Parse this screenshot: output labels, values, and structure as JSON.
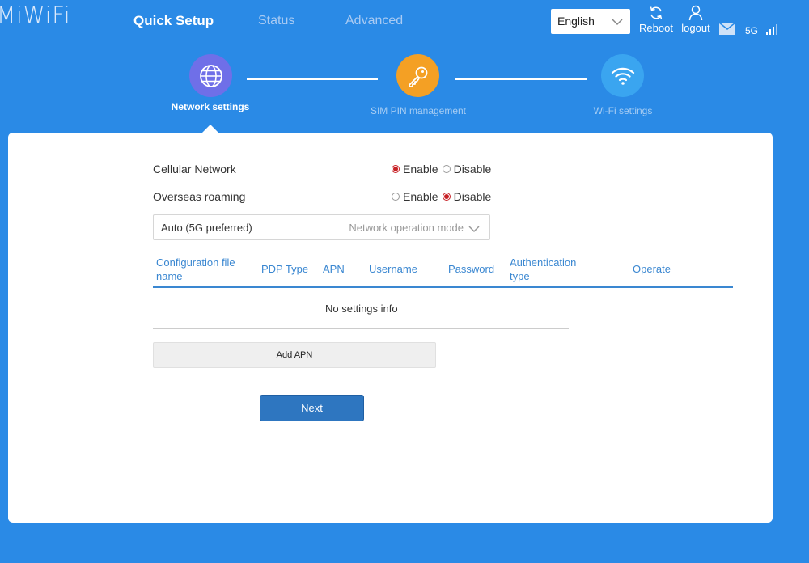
{
  "header": {
    "logo": "MiWiFi",
    "nav": [
      "Quick Setup",
      "Status",
      "Advanced"
    ],
    "language": "English",
    "reboot_label": "Reboot",
    "logout_label": "logout",
    "network_type": "5G"
  },
  "steps": [
    {
      "label": "Network settings",
      "icon": "globe-icon",
      "color": "#6f6fe8",
      "active": true
    },
    {
      "label": "SIM PIN management",
      "icon": "key-icon",
      "color": "#f4a024",
      "active": false
    },
    {
      "label": "Wi-Fi settings",
      "icon": "wifi-icon",
      "color": "#3aa5f0",
      "active": false
    }
  ],
  "form": {
    "cellular_network": {
      "label": "Cellular Network",
      "options": [
        "Enable",
        "Disable"
      ],
      "selected": "Enable"
    },
    "overseas_roaming": {
      "label": "Overseas roaming",
      "options": [
        "Enable",
        "Disable"
      ],
      "selected": "Disable"
    },
    "network_mode": {
      "value": "Auto (5G preferred)",
      "placeholder": "Network operation mode"
    }
  },
  "apn_table": {
    "headers": [
      "Configuration file name",
      "PDP Type",
      "APN",
      "Username",
      "Password",
      "Authentication type",
      "Operate"
    ],
    "empty_text": "No settings info"
  },
  "buttons": {
    "add_apn": "Add APN",
    "next": "Next"
  },
  "colors": {
    "background": "#2a8ae6",
    "accent": "#3a87d1",
    "primary_button": "#2e76c0",
    "radio_checked": "#c72025"
  }
}
